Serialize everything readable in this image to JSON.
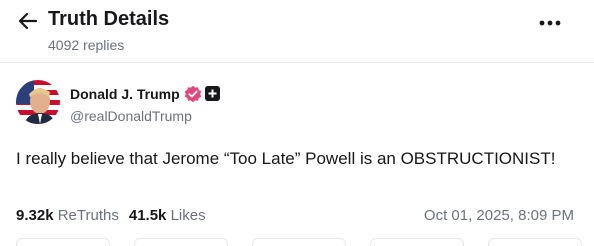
{
  "header": {
    "title": "Truth Details",
    "replies_count": "4092 replies",
    "back_icon": "arrow-left-icon",
    "more_icon": "ellipsis-horizontal-icon"
  },
  "post": {
    "author": {
      "name": "Donald J. Trump",
      "handle": "@realDonaldTrump",
      "verified": true,
      "verified_color": "#e4457a"
    },
    "text": "I really believe that Jerome “Too Late” Powell is an OBSTRUCTIONIST!",
    "retruths_count": "9.32k",
    "retruths_label": "ReTruths",
    "likes_count": "41.5k",
    "likes_label": "Likes",
    "timestamp": "Oct 01, 2025, 8:09 PM"
  }
}
